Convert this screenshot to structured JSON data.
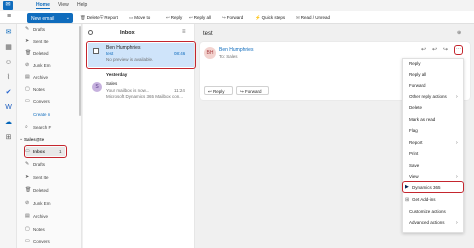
{
  "tabs": [
    "Home",
    "View",
    "Help"
  ],
  "toolbar": {
    "new_email": "New email",
    "delete": "Delete",
    "report": "Report",
    "move_to": "Move to",
    "reply": "Reply",
    "reply_all": "Reply all",
    "forward": "Forward",
    "quick_steps": "Quick steps",
    "read_unread": "Read / Unread"
  },
  "folders": {
    "drafts": "Drafts",
    "sent": "Sent Ite",
    "deleted": "Deleted",
    "junk": "Junk Em",
    "archive": "Archive",
    "notes": "Notes",
    "conversation": "Convers",
    "create_new": "Create n",
    "search": "Search F",
    "group": "Sales@te",
    "inbox": "Inbox",
    "inbox_count": "1",
    "drafts2": "Drafts",
    "sent2": "Sent Ite",
    "deleted2": "Deleted",
    "junk2": "Junk Em",
    "archive2": "Archive",
    "notes2": "Notes",
    "conversation2": "Convers"
  },
  "list": {
    "title": "Inbox",
    "section_yesterday": "Yesterday",
    "items": [
      {
        "avatar": "BH",
        "sender": "Ben Humphries",
        "subject": "test",
        "preview": "No preview is available.",
        "time": "08:46"
      },
      {
        "avatar": "S",
        "sender": "Sales",
        "subject": "Your mailbox is now...",
        "preview": "Microsoft Dynamics 365 Mailbox con...",
        "time": "11:24"
      }
    ]
  },
  "reading": {
    "subject": "test",
    "avatar": "BH",
    "sender": "Ben Humphries",
    "to": "To: Sales",
    "reply": "Reply",
    "forward": "Forward"
  },
  "menu": {
    "items": [
      "Reply",
      "Reply all",
      "Forward",
      "Other reply actions",
      "Delete",
      "Mark as read",
      "Flag",
      "Report",
      "Print",
      "Save",
      "View",
      "Dynamics 365",
      "Get Add-ins",
      "Customize actions",
      "Advanced actions"
    ]
  },
  "colors": {
    "accent": "#0f6cbd",
    "highlight": "#c4262e",
    "selected_bg": "#cfe4fa"
  }
}
